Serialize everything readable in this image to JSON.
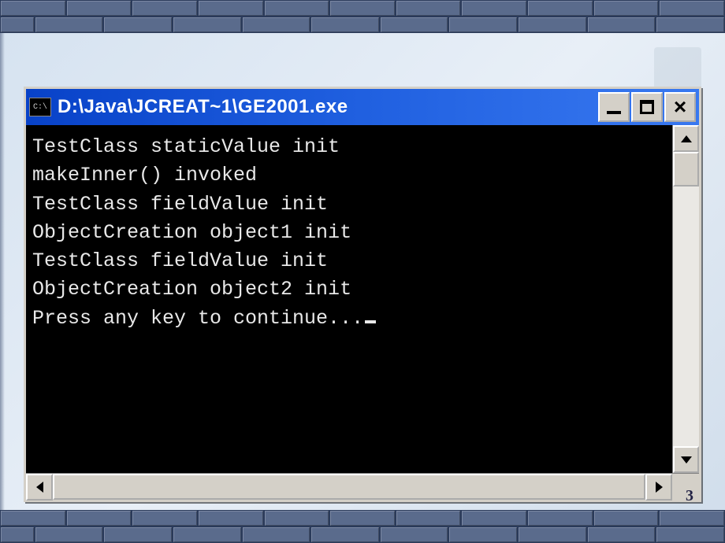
{
  "window": {
    "title": "D:\\Java\\JCREAT~1\\GE2001.exe",
    "icon_label": "C:\\"
  },
  "console": {
    "lines": [
      "TestClass staticValue init",
      "makeInner() invoked",
      "TestClass fieldValue init",
      "ObjectCreation object1 init",
      "TestClass fieldValue init",
      "ObjectCreation object2 init",
      "Press any key to continue..."
    ]
  },
  "page_number": "3"
}
